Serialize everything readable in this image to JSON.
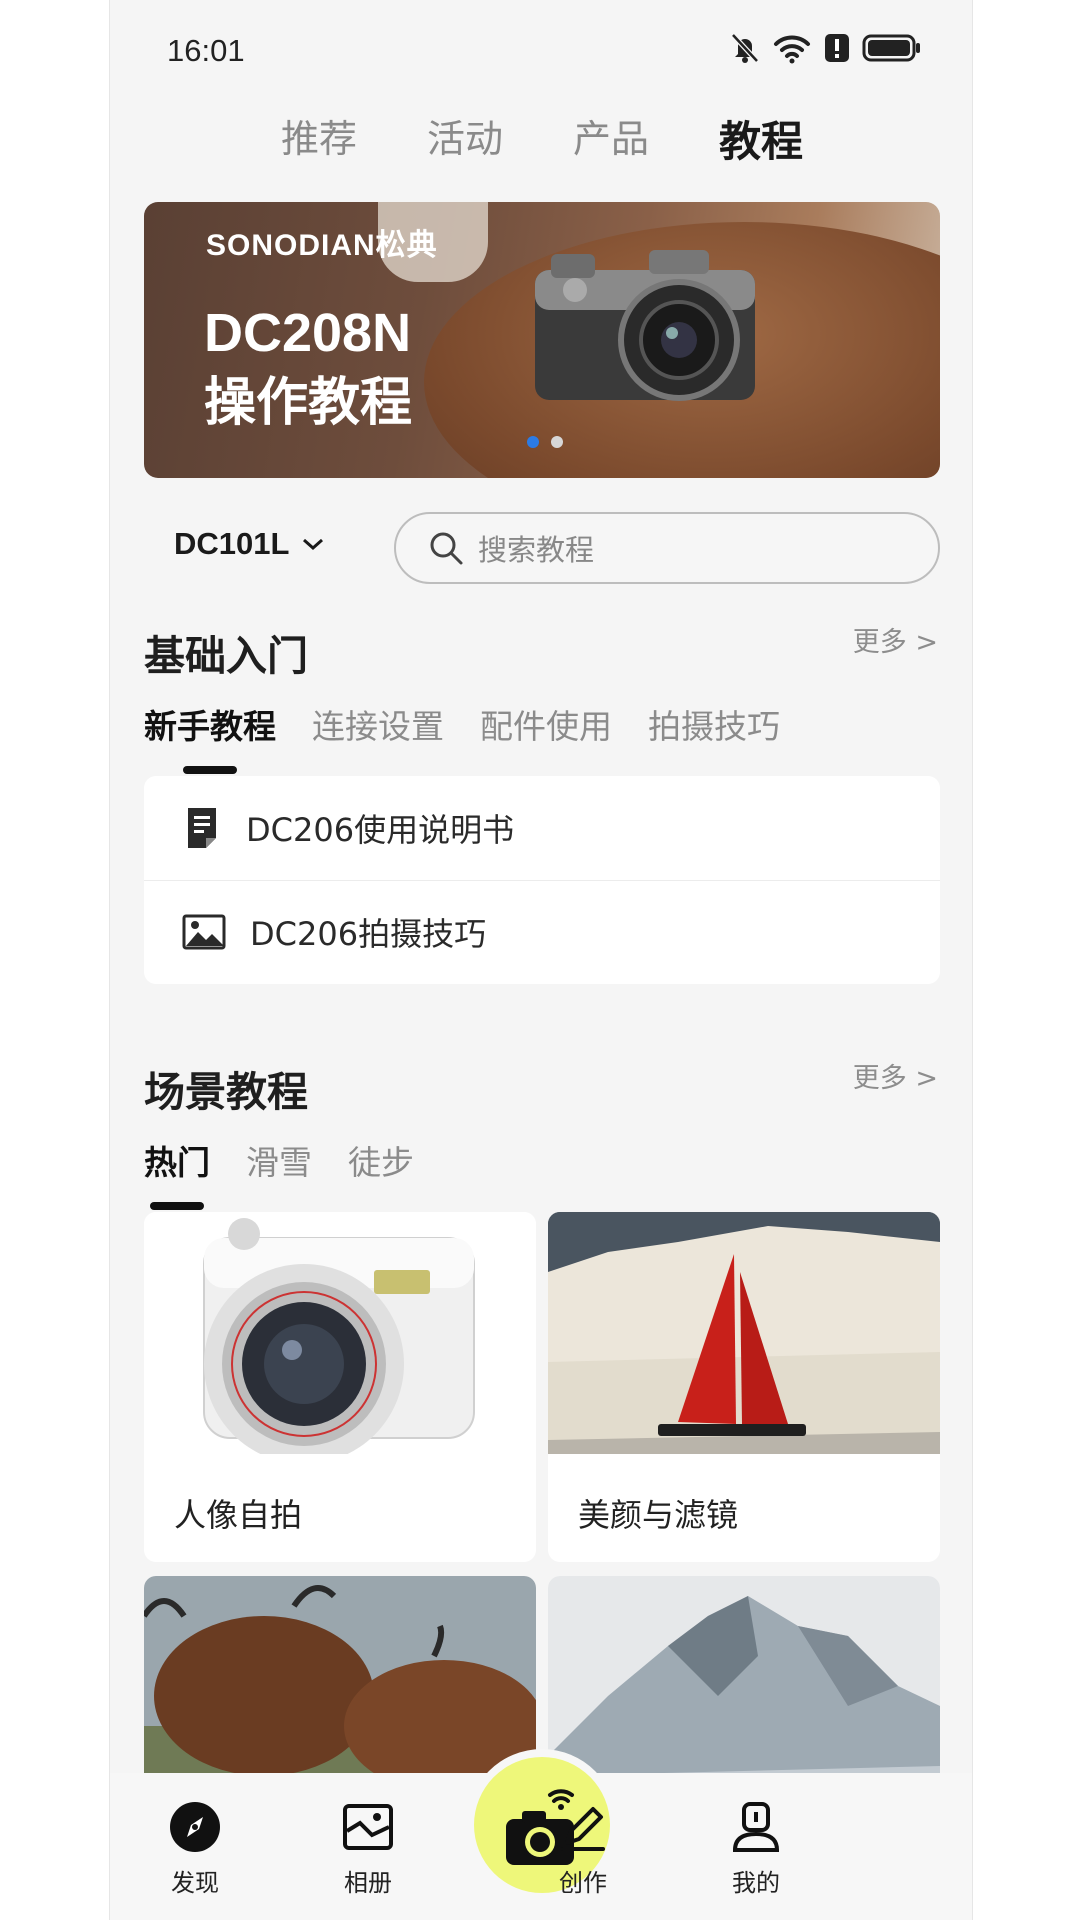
{
  "status_bar": {
    "time": "16:01"
  },
  "top_tabs": [
    "推荐",
    "活动",
    "产品",
    "教程"
  ],
  "banner": {
    "brand": "SONODIAN松典",
    "title_line1": "DC208N",
    "title_line2": "操作教程",
    "page_count": 2,
    "active_page": 1
  },
  "model_selector": {
    "value": "DC101L"
  },
  "search": {
    "placeholder": "搜索教程"
  },
  "basics": {
    "title": "基础入门",
    "more": "更多 >",
    "tabs": [
      "新手教程",
      "连接设置",
      "配件使用",
      "拍摄技巧"
    ],
    "active_tab": "新手教程",
    "items": [
      {
        "label": "DC206使用说明书",
        "icon": "document-icon"
      },
      {
        "label": "DC206拍摄技巧",
        "icon": "image-icon"
      }
    ]
  },
  "scenes": {
    "title": "场景教程",
    "more": "更多 >",
    "tabs": [
      "热门",
      "滑雪",
      "徒步"
    ],
    "active_tab": "热门",
    "cards": [
      {
        "caption": "人像自拍"
      },
      {
        "caption": "美颜与滤镜"
      },
      {
        "caption": ""
      },
      {
        "caption": ""
      }
    ]
  },
  "bottom_nav": {
    "discover": "发现",
    "album": "相册",
    "create": "创作",
    "mine": "我的"
  },
  "colors": {
    "accent_yellow": "#eef77a",
    "dot_active": "#2c7be5",
    "background": "#f5f5f5"
  }
}
